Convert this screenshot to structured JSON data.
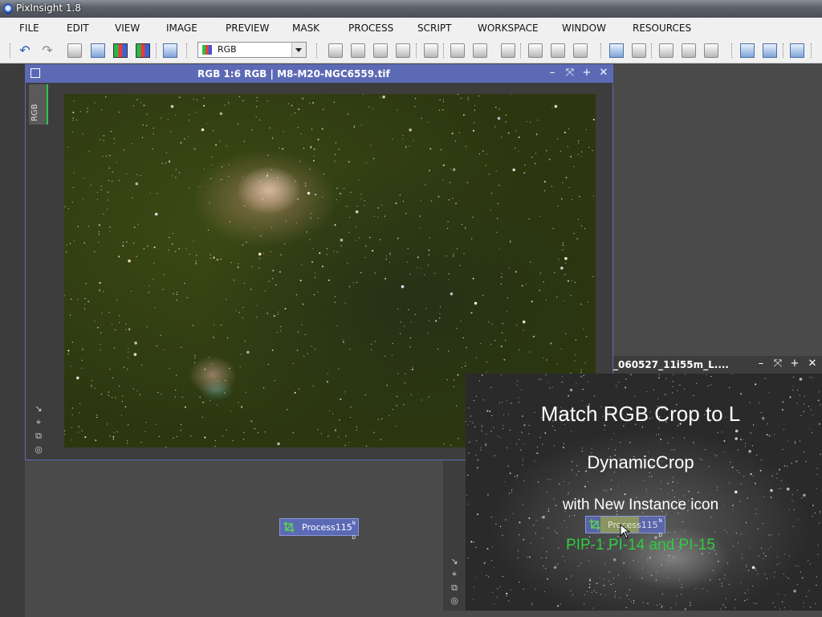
{
  "app": {
    "title": "PixInsight 1.8"
  },
  "menu": [
    "FILE",
    "EDIT",
    "VIEW",
    "IMAGE",
    "PREVIEW",
    "MASK",
    "PROCESS",
    "SCRIPT",
    "WORKSPACE",
    "WINDOW",
    "RESOURCES"
  ],
  "toolbar": {
    "channel_select_value": "RGB"
  },
  "rgb_window": {
    "title": "RGB 1:6 RGB | M8-M20-NGC6559.tif",
    "tab_label": "RGB",
    "controls": [
      "–",
      "⤧",
      "+",
      "✕"
    ]
  },
  "l_window": {
    "title": "_060527_11i55m_L....",
    "controls": [
      "–",
      "⤧",
      "+",
      "✕"
    ]
  },
  "process_icon": {
    "label": "Process115"
  },
  "overlay": {
    "line1": "Match RGB Crop to L",
    "line2": "DynamicCrop",
    "line3": "with New Instance icon",
    "line4": "PIP-1 PI-14 and PI-15",
    "accent_color": "#2ecc40"
  },
  "colors": {
    "window_title": "#5c6ab6"
  }
}
